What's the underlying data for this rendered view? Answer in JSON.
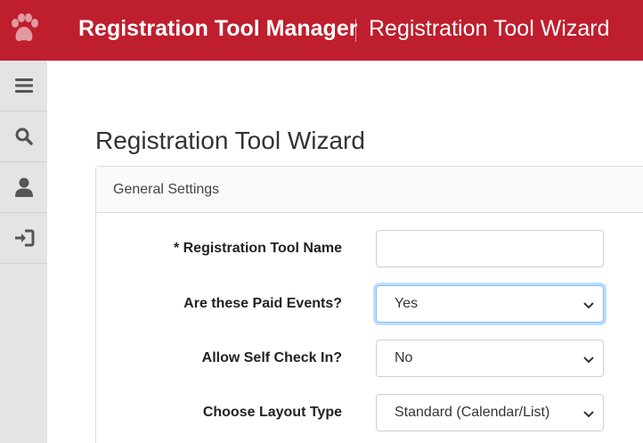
{
  "header": {
    "app_title": "Registration Tool Manager",
    "page_crumb": "Registration Tool Wizard",
    "logo_icon": "paw-print-icon",
    "colors": {
      "brand": "#be1e2d",
      "text": "#ffffff"
    }
  },
  "sidebar": {
    "items": [
      {
        "icon": "menu-icon"
      },
      {
        "icon": "search-icon"
      },
      {
        "icon": "user-icon"
      },
      {
        "icon": "sign-in-icon"
      }
    ]
  },
  "main": {
    "title": "Registration Tool Wizard",
    "panel": {
      "header": "General Settings",
      "fields": [
        {
          "label": "* Registration Tool Name",
          "type": "text",
          "value": ""
        },
        {
          "label": "Are these Paid Events?",
          "type": "select",
          "value": "Yes"
        },
        {
          "label": "Allow Self Check In?",
          "type": "select",
          "value": "No"
        },
        {
          "label": "Choose Layout Type",
          "type": "select",
          "value": "Standard (Calendar/List)"
        }
      ]
    }
  }
}
